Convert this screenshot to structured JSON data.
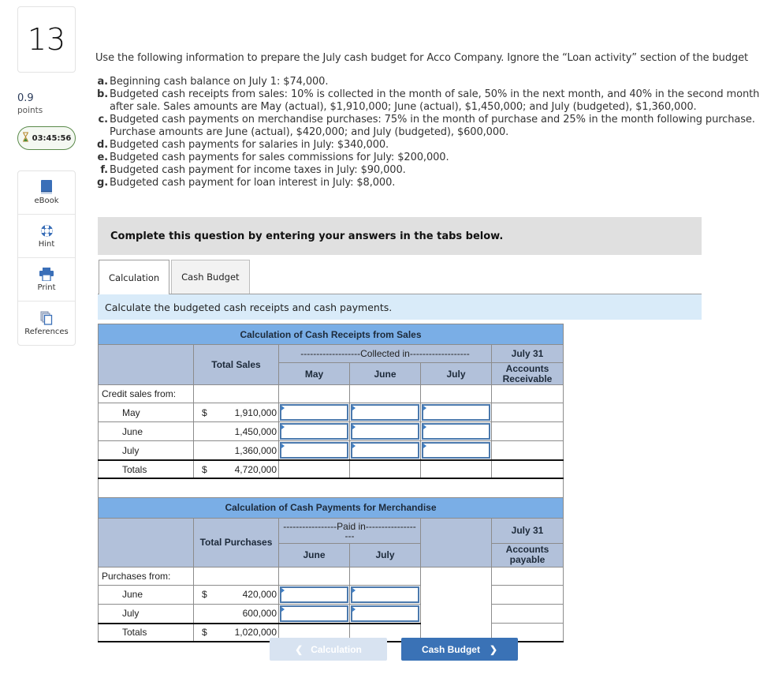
{
  "question": {
    "number": "13",
    "points_value": "0.9",
    "points_label": "points",
    "timer": "03:45:56"
  },
  "tools": [
    {
      "label": "eBook",
      "icon": "book-icon"
    },
    {
      "label": "Hint",
      "icon": "lifebuoy-icon"
    },
    {
      "label": "Print",
      "icon": "printer-icon"
    },
    {
      "label": "References",
      "icon": "references-icon"
    }
  ],
  "intro": "Use the following information to prepare the July cash budget for Acco Company. Ignore the “Loan activity” section of the budget",
  "info_items": [
    {
      "letter": "a.",
      "text": "Beginning cash balance on July 1: $74,000."
    },
    {
      "letter": "b.",
      "text": "Budgeted cash receipts from sales: 10% is collected in the month of sale, 50% in the next month, and 40% in the second month after sale. Sales amounts are May (actual), $1,910,000; June (actual), $1,450,000; and July (budgeted), $1,360,000."
    },
    {
      "letter": "c.",
      "text": "Budgeted cash payments on merchandise purchases: 75% in the month of purchase and 25% in the month following purchase. Purchase amounts are June (actual), $420,000; and July (budgeted), $600,000."
    },
    {
      "letter": "d.",
      "text": "Budgeted cash payments for salaries in July: $340,000."
    },
    {
      "letter": "e.",
      "text": "Budgeted cash payments for sales commissions for July: $200,000."
    },
    {
      "letter": "f.",
      "text": "Budgeted cash payment for income taxes in July: $90,000."
    },
    {
      "letter": "g.",
      "text": "Budgeted cash payment for loan interest in July: $8,000."
    }
  ],
  "complete_prompt": "Complete this question by entering your answers in the tabs below.",
  "tabs": [
    {
      "label": "Calculation",
      "active": true
    },
    {
      "label": "Cash Budget",
      "active": false
    }
  ],
  "instruction": "Calculate the budgeted cash receipts and cash payments.",
  "receipts": {
    "title": "Calculation of Cash Receipts from Sales",
    "total_header": "Total Sales",
    "collected_header": "-------------------Collected in-------------------",
    "cols": [
      "May",
      "June",
      "July"
    ],
    "ar_header_top": "July 31",
    "ar_header_bottom": "Accounts Receivable",
    "section_label": "Credit sales from:",
    "rows": [
      {
        "label": "May",
        "dollar": "$",
        "total": "1,910,000",
        "may": "",
        "june": "",
        "july": ""
      },
      {
        "label": "June",
        "dollar": "",
        "total": "1,450,000",
        "may": "",
        "june": "",
        "july": ""
      },
      {
        "label": "July",
        "dollar": "",
        "total": "1,360,000",
        "may": "",
        "june": "",
        "july": ""
      }
    ],
    "totals": {
      "label": "Totals",
      "dollar": "$",
      "total": "4,720,000"
    }
  },
  "payments": {
    "title": "Calculation of Cash Payments for Merchandise",
    "total_header": "Total Purchases",
    "paid_header": "-----------------Paid in----------------",
    "paid_header_cont": "---",
    "cols": [
      "June",
      "July"
    ],
    "ap_header_top": "July 31",
    "ap_header_bottom": "Accounts payable",
    "section_label": "Purchases from:",
    "rows": [
      {
        "label": "June",
        "dollar": "$",
        "total": "420,000",
        "june": "",
        "july": ""
      },
      {
        "label": "July",
        "dollar": "",
        "total": "600,000",
        "june": "",
        "july": ""
      }
    ],
    "totals": {
      "label": "Totals",
      "dollar": "$",
      "total": "1,020,000"
    }
  },
  "nav": {
    "prev_label": "Calculation",
    "next_label": "Cash Budget",
    "prev_enabled": false
  }
}
